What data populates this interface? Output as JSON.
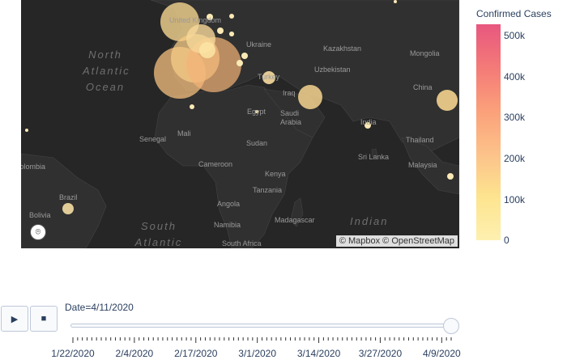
{
  "map": {
    "country_labels": [
      "United Kingdom",
      "Ukraine",
      "Kazakhstan",
      "Mongolia",
      "Uzbekistan",
      "Turkey",
      "Iraq",
      "China",
      "Egypt",
      "Saudi Arabia",
      "India",
      "Mali",
      "Senegal",
      "Sudan",
      "Thailand",
      "Sri Lanka",
      "Malaysia",
      "Cameroon",
      "Kenya",
      "Tanzania",
      "Angola",
      "Namibia",
      "Madagascar",
      "South Africa",
      "Brazil",
      "Bolivia",
      "Colombia"
    ],
    "ocean_labels": {
      "north_atlantic": [
        "North",
        "Atlantic",
        "Ocean"
      ],
      "south_atlantic": [
        "South",
        "Atlantic"
      ],
      "indian": "Indian"
    },
    "attribution": "© Mapbox © OpenStreetMap",
    "logo_icon": "mapbox-logo-icon",
    "land_color": "#303030",
    "water_color": "#262626"
  },
  "colorbar": {
    "title": "Confirmed Cases",
    "ticks": [
      "500k",
      "400k",
      "300k",
      "200k",
      "100k",
      "0"
    ],
    "colors": [
      "#e8577f",
      "#f47a78",
      "#fba07a",
      "#fcc28a",
      "#fde48f",
      "#fdf0b0"
    ]
  },
  "animation": {
    "play_icon": "▶",
    "stop_icon": "■",
    "current_label": "Date=4/11/2020",
    "position": 1.0,
    "tick_labels": [
      "1/22/2020",
      "2/4/2020",
      "2/17/2020",
      "3/1/2020",
      "3/14/2020",
      "3/27/2020",
      "4/9/2020"
    ]
  }
}
